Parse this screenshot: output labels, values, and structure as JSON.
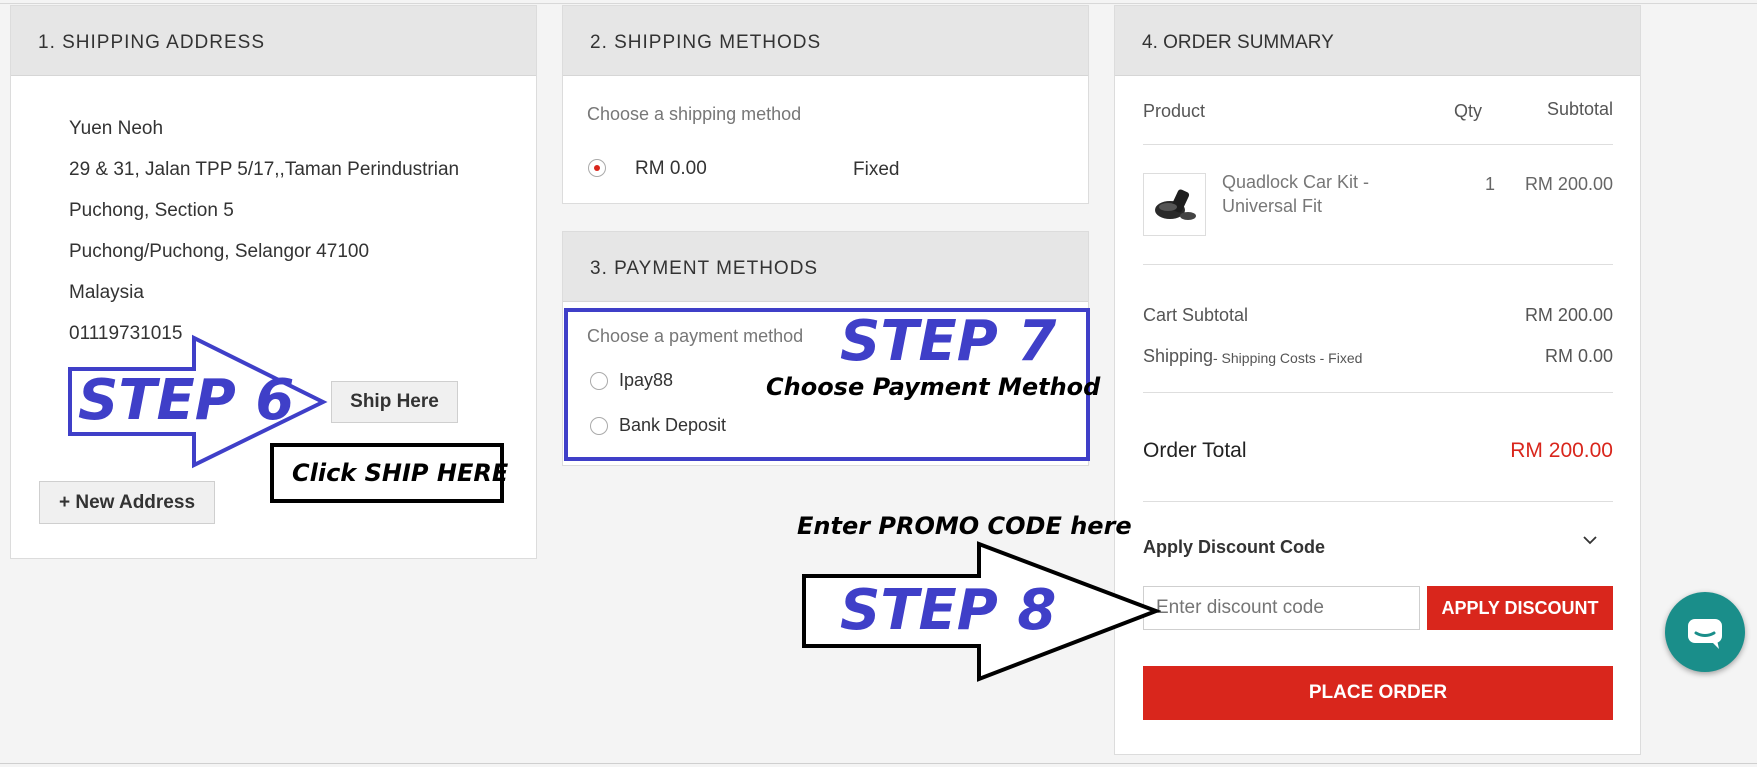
{
  "shipping_address": {
    "title": "1. SHIPPING ADDRESS",
    "lines": [
      "Yuen Neoh",
      "29 & 31, Jalan TPP 5/17,,Taman Perindustrian",
      "Puchong, Section 5",
      "Puchong/Puchong, Selangor 47100",
      "Malaysia",
      "01119731015"
    ],
    "ship_here_label": "Ship Here",
    "new_address_label": "+ New Address"
  },
  "shipping_methods": {
    "title": "2. SHIPPING METHODS",
    "prompt": "Choose a shipping method",
    "options": [
      {
        "price": "RM 0.00",
        "carrier": "Fixed",
        "selected": true
      }
    ]
  },
  "payment_methods": {
    "title": "3. PAYMENT METHODS",
    "prompt": "Choose a payment method",
    "options": [
      {
        "label": "Ipay88",
        "selected": false
      },
      {
        "label": "Bank Deposit",
        "selected": false
      }
    ]
  },
  "order_summary": {
    "title": "4. ORDER SUMMARY",
    "columns": {
      "product": "Product",
      "qty": "Qty",
      "subtotal": "Subtotal"
    },
    "items": [
      {
        "name_line1": "Quadlock Car Kit -",
        "name_line2": "Universal Fit",
        "qty": "1",
        "subtotal": "RM 200.00",
        "icon": "car-mount-product-image"
      }
    ],
    "cart_subtotal_label": "Cart Subtotal",
    "cart_subtotal_value": "RM 200.00",
    "shipping_label": "Shipping",
    "shipping_detail": "- Shipping Costs - Fixed",
    "shipping_value": "RM 0.00",
    "order_total_label": "Order Total",
    "order_total_value": "RM 200.00",
    "discount_label": "Apply Discount Code",
    "discount_placeholder": "Enter discount code",
    "apply_discount_label": "APPLY DISCOUNT",
    "place_order_label": "PLACE ORDER"
  },
  "annotations": {
    "step6": "STEP 6",
    "step6_note": "Click SHIP HERE",
    "step7": "STEP 7",
    "step7_note": "Choose Payment Method",
    "step8": "STEP 8",
    "step8_note": "Enter PROMO CODE here"
  },
  "colors": {
    "accent_red": "#d9261c",
    "annotation_blue": "#3f3fc8",
    "chat_teal": "#1a8e8a"
  }
}
